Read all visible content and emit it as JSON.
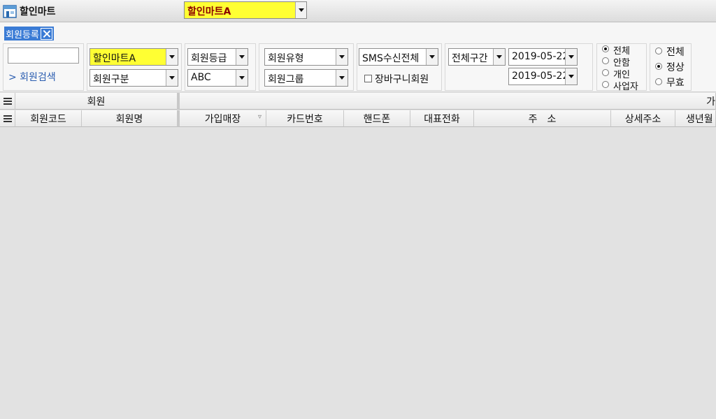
{
  "app": {
    "title": "할인마트",
    "store": "할인마트A"
  },
  "tab": {
    "label": "회원등록"
  },
  "filters": {
    "search_input": "",
    "search_link": "> 회원검색",
    "store": "할인마트A",
    "member_division": "회원구분",
    "member_grade": "회원등급",
    "abc": "ABC",
    "member_type": "회원유형",
    "member_group": "회원그룹",
    "sms": "SMS수신전체",
    "cart_member": "장바구니회원",
    "period": "전체구간",
    "date_from": "2019-05-22",
    "date_to": "2019-05-22",
    "radio_group1": [
      {
        "label": "전체",
        "checked": true
      },
      {
        "label": "안함",
        "checked": false
      },
      {
        "label": "개인",
        "checked": false
      },
      {
        "label": "사업자",
        "checked": false
      }
    ],
    "radio_group2": [
      {
        "label": "전체",
        "checked": false
      },
      {
        "label": "정상",
        "checked": true
      },
      {
        "label": "무효",
        "checked": false
      }
    ]
  },
  "grid": {
    "band_member": "회원",
    "band_right": "가",
    "columns": [
      "회원코드",
      "회원명",
      "가입매장",
      "카드번호",
      "핸드폰",
      "대표전화",
      "주　소",
      "상세주소",
      "생년월"
    ]
  }
}
